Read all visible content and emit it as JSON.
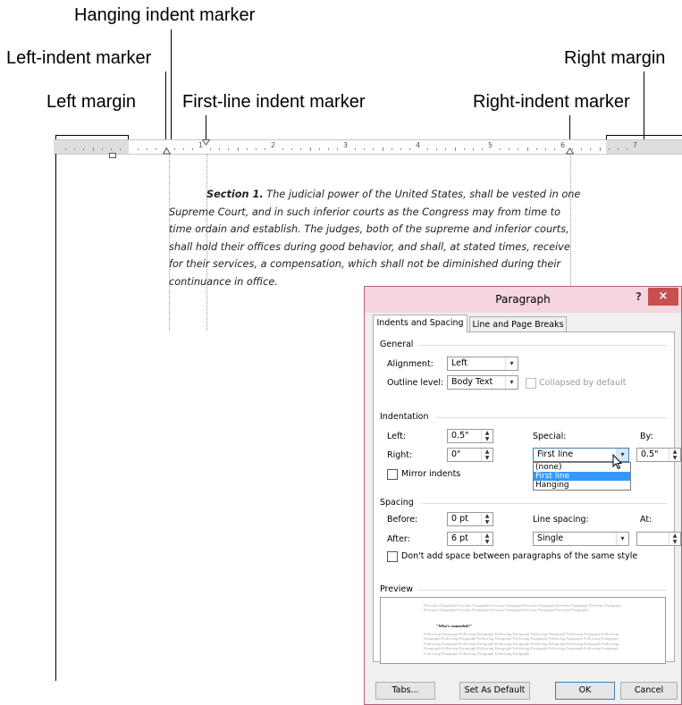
{
  "callouts": {
    "hanging_indent": "Hanging indent marker",
    "left_indent": "Left-indent marker",
    "right_margin": "Right margin",
    "left_margin": "Left margin",
    "first_line_indent": "First-line indent marker",
    "right_indent": "Right-indent marker"
  },
  "ruler": {
    "numbers": [
      "1",
      "2",
      "3",
      "4",
      "5",
      "6",
      "7"
    ]
  },
  "document": {
    "lines": [
      {
        "bold": "Section 1.",
        "text": " The judicial power of the United States, shall be vested in one"
      },
      {
        "bold": "",
        "text": "Supreme Court, and in such inferior courts as the Congress may from time to"
      },
      {
        "bold": "",
        "text": "time ordain and establish. The judges, both of the supreme and inferior courts,"
      },
      {
        "bold": "",
        "text": "shall hold their offices during good behavior, and shall, at stated times, receive"
      },
      {
        "bold": "",
        "text": "for their services, a compensation, which shall not be diminished during their"
      },
      {
        "bold": "",
        "text": "continuance in office."
      }
    ]
  },
  "dialog": {
    "title": "Paragraph",
    "help": "?",
    "close": "×",
    "tabs": [
      "Indents and Spacing",
      "Line and Page Breaks"
    ],
    "general": {
      "heading": "General",
      "alignment_label": "Alignment:",
      "alignment_value": "Left",
      "outline_label": "Outline level:",
      "outline_value": "Body Text",
      "collapsed_label": "Collapsed by default"
    },
    "indentation": {
      "heading": "Indentation",
      "left_label": "Left:",
      "left_value": "0.5\"",
      "right_label": "Right:",
      "right_value": "0\"",
      "special_label": "Special:",
      "special_value": "First line",
      "by_label": "By:",
      "by_value": "0.5\"",
      "mirror_label": "Mirror indents",
      "special_options": [
        "(none)",
        "First line",
        "Hanging"
      ],
      "special_selected_index": 1
    },
    "spacing": {
      "heading": "Spacing",
      "before_label": "Before:",
      "before_value": "0 pt",
      "after_label": "After:",
      "after_value": "6 pt",
      "line_spacing_label": "Line spacing:",
      "line_spacing_value": "Single",
      "at_label": "At:",
      "at_value": "",
      "dont_add_label": "Don't add space between paragraphs of the same style"
    },
    "preview": {
      "heading": "Preview",
      "previous_text": "Previous Paragraph Previous Paragraph Previous Paragraph Previous Paragraph Previous Paragraph Previous Paragraph Previous Paragraph Previous Paragraph Previous Paragraph Previous Paragraph Previous Paragraph",
      "sample_text": "\"Who's counseled?\"",
      "following_text": "Following Paragraph Following Paragraph Following Paragraph Following Paragraph Following Paragraph Following Paragraph Following Paragraph Following Paragraph Following Paragraph Following Paragraph Following Paragraph Following Paragraph Following Paragraph Following Paragraph Following Paragraph Following Paragraph Following Paragraph Following Paragraph Following Paragraph Following Paragraph Following Paragraph Following Paragraph Following Paragraph Following Paragraph Following Paragraph"
    },
    "buttons": {
      "tabs": "Tabs...",
      "set_default": "Set As Default",
      "ok": "OK",
      "cancel": "Cancel"
    }
  }
}
